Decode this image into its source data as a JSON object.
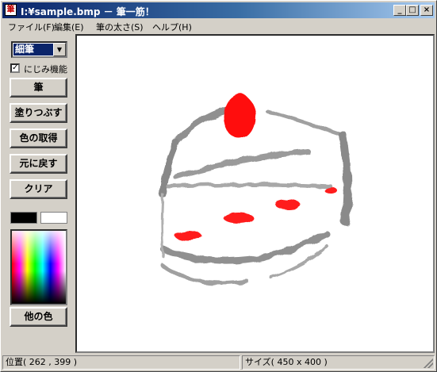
{
  "window": {
    "title": "I:¥sample.bmp － 筆一筋！",
    "icon": "brush-app-icon",
    "icon_glyph": "筆",
    "controls": {
      "minimize": "_",
      "maximize": "□",
      "close": "×"
    }
  },
  "menu": [
    {
      "label": "ファイル(F)"
    },
    {
      "label": "編集(E)"
    },
    {
      "label": "筆の太さ(S)"
    },
    {
      "label": "ヘルプ(H)"
    }
  ],
  "tools": {
    "brush_size": {
      "selected": "細筆",
      "arrow": "▼"
    },
    "blur_checkbox": {
      "label": "にじみ機能",
      "checked": true,
      "mark": "✓"
    },
    "buttons": [
      "筆",
      "塗りつぶす",
      "色の取得",
      "元に戻す",
      "クリア"
    ],
    "primary_color": "#000000",
    "secondary_color": "#ffffff",
    "other_color_label": "他の色"
  },
  "canvas": {
    "drawing": "strawberry shortcake",
    "colors": {
      "shade": "#909090",
      "strawberry": "#ff1010"
    }
  },
  "status": {
    "position": "位置( 262 , 399 )",
    "size": "サイズ( 450 x 400 )"
  }
}
